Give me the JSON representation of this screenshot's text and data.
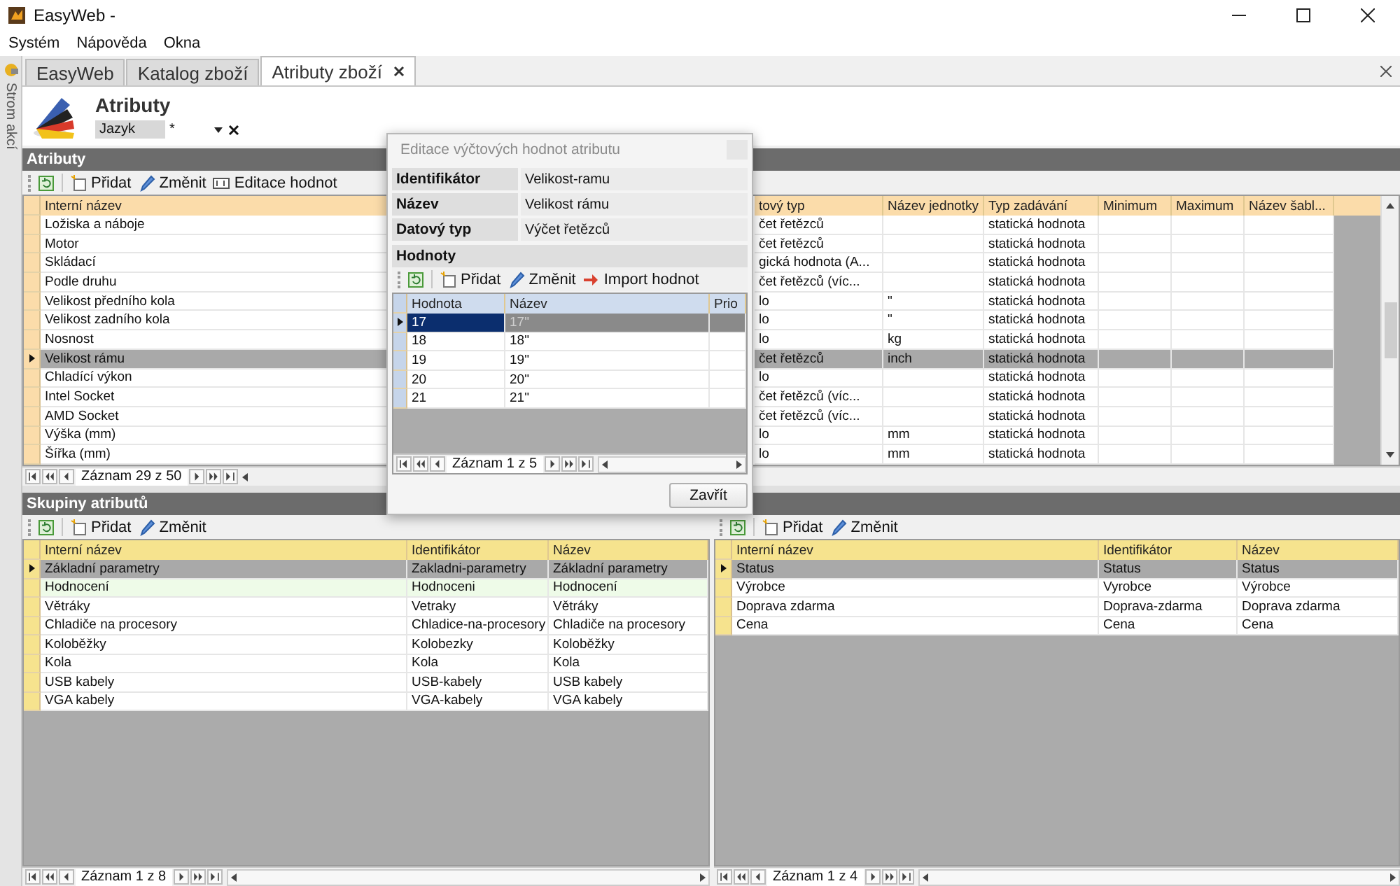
{
  "window": {
    "title": "EasyWeb -"
  },
  "menu": [
    "Systém",
    "Nápověda",
    "Okna"
  ],
  "side_strip": {
    "label": "Strom akcí"
  },
  "tabs": [
    {
      "label": "EasyWeb",
      "selected": false,
      "closable": false
    },
    {
      "label": "Katalog zboží",
      "selected": false,
      "closable": false
    },
    {
      "label": "Atributy zboží",
      "selected": true,
      "closable": true
    }
  ],
  "header": {
    "title": "Atributy",
    "language": {
      "label": "Jazyk",
      "value": "*"
    }
  },
  "attributes": {
    "title": "Atributy",
    "toolbar": [
      {
        "kind": "refresh"
      },
      {
        "kind": "add",
        "label": "Přidat"
      },
      {
        "kind": "edit",
        "label": "Změnit"
      },
      {
        "kind": "values",
        "label": "Editace hodnot"
      }
    ],
    "columns": [
      "Interní název",
      "tový typ",
      "Název jednotky",
      "Typ zadávání",
      "Minimum",
      "Maximum",
      "Název šabl..."
    ],
    "rows": [
      {
        "cells": [
          "Ložiska a náboje",
          "čet řetězců",
          "",
          "statická hodnota",
          "",
          "",
          ""
        ],
        "selected": false
      },
      {
        "cells": [
          "Motor",
          "čet řetězců",
          "",
          "statická hodnota",
          "",
          "",
          ""
        ],
        "selected": false
      },
      {
        "cells": [
          "Skládací",
          "gická hodnota (A...",
          "",
          "statická hodnota",
          "",
          "",
          ""
        ],
        "selected": false
      },
      {
        "cells": [
          "Podle druhu",
          "čet řetězců (víc...",
          "",
          "statická hodnota",
          "",
          "",
          ""
        ],
        "selected": false
      },
      {
        "cells": [
          "Velikost předního kola",
          "lo",
          "\"",
          "statická hodnota",
          "",
          "",
          ""
        ],
        "selected": false
      },
      {
        "cells": [
          "Velikost zadního kola",
          "lo",
          "\"",
          "statická hodnota",
          "",
          "",
          ""
        ],
        "selected": false
      },
      {
        "cells": [
          "Nosnost",
          "lo",
          "kg",
          "statická hodnota",
          "",
          "",
          ""
        ],
        "selected": false
      },
      {
        "cells": [
          "Velikost rámu",
          "čet řetězců",
          "inch",
          "statická hodnota",
          "",
          "",
          ""
        ],
        "selected": true
      },
      {
        "cells": [
          "Chladící výkon",
          "lo",
          "",
          "statická hodnota",
          "",
          "",
          ""
        ],
        "selected": false
      },
      {
        "cells": [
          "Intel Socket",
          "čet řetězců (víc...",
          "",
          "statická hodnota",
          "",
          "",
          ""
        ],
        "selected": false
      },
      {
        "cells": [
          "AMD Socket",
          "čet řetězců (víc...",
          "",
          "statická hodnota",
          "",
          "",
          ""
        ],
        "selected": false
      },
      {
        "cells": [
          "Výška (mm)",
          "lo",
          "mm",
          "statická hodnota",
          "",
          "",
          ""
        ],
        "selected": false
      },
      {
        "cells": [
          "Šířka (mm)",
          "lo",
          "mm",
          "statická hodnota",
          "",
          "",
          ""
        ],
        "selected": false
      }
    ],
    "pager": "Záznam 29 z 50"
  },
  "dialog": {
    "title": "Editace výčtových hodnot atributu",
    "fields": [
      {
        "label": "Identifikátor",
        "value": "Velikost-ramu"
      },
      {
        "label": "Název",
        "value": "Velikost rámu"
      },
      {
        "label": "Datový typ",
        "value": "Výčet řetězců"
      }
    ],
    "values": {
      "title": "Hodnoty",
      "toolbar": [
        {
          "kind": "refresh"
        },
        {
          "kind": "add",
          "label": "Přidat"
        },
        {
          "kind": "edit",
          "label": "Změnit"
        },
        {
          "kind": "import",
          "label": "Import hodnot"
        }
      ],
      "columns": [
        "Hodnota",
        "Název",
        "Prio"
      ],
      "rows": [
        {
          "cells": [
            "17",
            "17\"",
            ""
          ],
          "selected": true
        },
        {
          "cells": [
            "18",
            "18\"",
            ""
          ],
          "selected": false
        },
        {
          "cells": [
            "19",
            "19\"",
            ""
          ],
          "selected": false
        },
        {
          "cells": [
            "20",
            "20\"",
            ""
          ],
          "selected": false
        },
        {
          "cells": [
            "21",
            "21\"",
            ""
          ],
          "selected": false
        }
      ],
      "pager": "Záznam 1 z 5"
    },
    "close_button": "Zavřít"
  },
  "groups": {
    "title": "Skupiny atributů",
    "left": {
      "toolbar": [
        {
          "kind": "refresh"
        },
        {
          "kind": "add",
          "label": "Přidat"
        },
        {
          "kind": "edit",
          "label": "Změnit"
        }
      ],
      "columns": [
        "Interní název",
        "Identifikátor",
        "Název"
      ],
      "rows": [
        {
          "cells": [
            "Základní parametry",
            "Zakladni-parametry",
            "Základní parametry"
          ],
          "selected": true,
          "hovered": false
        },
        {
          "cells": [
            "Hodnocení",
            "Hodnoceni",
            "Hodnocení"
          ],
          "selected": false,
          "hovered": true
        },
        {
          "cells": [
            "Větráky",
            "Vetraky",
            "Větráky"
          ],
          "selected": false,
          "hovered": false
        },
        {
          "cells": [
            "Chladiče na procesory",
            "Chladice-na-procesory",
            "Chladiče na procesory"
          ],
          "selected": false,
          "hovered": false
        },
        {
          "cells": [
            "Koloběžky",
            "Kolobezky",
            "Koloběžky"
          ],
          "selected": false,
          "hovered": false
        },
        {
          "cells": [
            "Kola",
            "Kola",
            "Kola"
          ],
          "selected": false,
          "hovered": false
        },
        {
          "cells": [
            "USB kabely",
            "USB-kabely",
            "USB kabely"
          ],
          "selected": false,
          "hovered": false
        },
        {
          "cells": [
            "VGA kabely",
            "VGA-kabely",
            "VGA kabely"
          ],
          "selected": false,
          "hovered": false
        }
      ],
      "pager": "Záznam 1 z 8"
    },
    "right": {
      "toolbar": [
        {
          "kind": "refresh"
        },
        {
          "kind": "add",
          "label": "Přidat"
        },
        {
          "kind": "edit",
          "label": "Změnit"
        }
      ],
      "columns": [
        "Interní název",
        "Identifikátor",
        "Název"
      ],
      "rows": [
        {
          "cells": [
            "Status",
            "Status",
            "Status"
          ],
          "selected": true,
          "hovered": false
        },
        {
          "cells": [
            "Výrobce",
            "Vyrobce",
            "Výrobce"
          ],
          "selected": false,
          "hovered": false
        },
        {
          "cells": [
            "Doprava zdarma",
            "Doprava-zdarma",
            "Doprava zdarma"
          ],
          "selected": false,
          "hovered": false
        },
        {
          "cells": [
            "Cena",
            "Cena",
            "Cena"
          ],
          "selected": false,
          "hovered": false
        }
      ],
      "pager": "Záznam 1 z 4"
    }
  }
}
